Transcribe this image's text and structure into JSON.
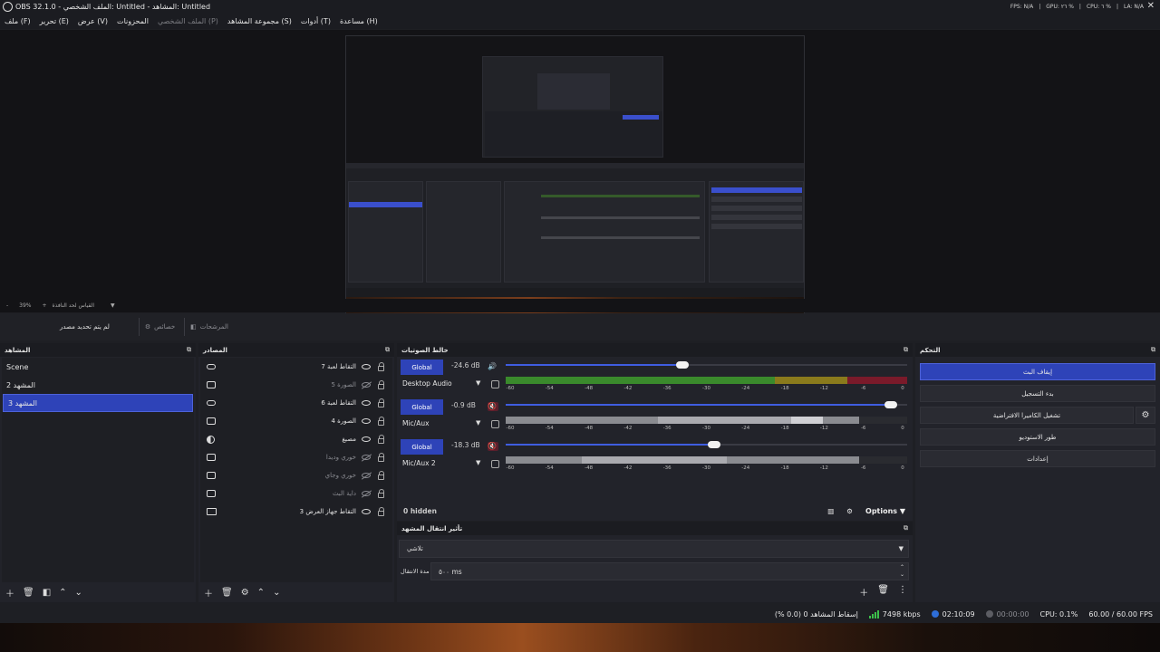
{
  "window": {
    "title": "OBS 32.1.0 - الملف الشخصي: Untitled - المشاهد: Untitled",
    "status_right": [
      "FPS: N/A",
      "GPU: ٢٦ %",
      "CPU: ٦ %",
      "LA: N/A"
    ]
  },
  "menu": [
    "ملف (F)",
    "تحرير (E)",
    "عرض (V)",
    "المحزونات",
    "الملف الشخصي (P)",
    "مجموعة المشاهد (S)",
    "أدوات (T)",
    "مساعدة (H)"
  ],
  "zoom": {
    "minus": "-",
    "percent": "39%",
    "plus": "+",
    "fit": "القياس لحد النافذة"
  },
  "context": {
    "no_source": "لم يتم تحديد مصدر",
    "properties": "خصائص",
    "filters": "المرشحات"
  },
  "scenes": {
    "title": "المشاهد",
    "items": [
      "Scene",
      "المشهد 2",
      "المشهد 3"
    ],
    "active_index": 2
  },
  "sources": {
    "title": "المصادر",
    "items": [
      {
        "name": "التقاط لعبة 7",
        "icon": "gamepad-icon",
        "visible": true
      },
      {
        "name": "الصورة 5",
        "icon": "image-icon",
        "visible": false
      },
      {
        "name": "التقاط لعبة 6",
        "icon": "gamepad-icon",
        "visible": true
      },
      {
        "name": "الصورة 4",
        "icon": "image-icon",
        "visible": true
      },
      {
        "name": "مصبغ",
        "icon": "color-source-icon",
        "visible": true
      },
      {
        "name": "خوري وديدا",
        "icon": "image-icon",
        "visible": false
      },
      {
        "name": "خوري وجاي",
        "icon": "image-icon",
        "visible": false
      },
      {
        "name": "داية البث",
        "icon": "image-icon",
        "visible": false
      },
      {
        "name": "التقاط جهاز العرض 3",
        "icon": "display-capture-icon",
        "visible": true
      }
    ]
  },
  "mixer": {
    "title": "خالط الصوتيات",
    "channels": [
      {
        "label": "Global",
        "db": "-24.6 dB",
        "name": "Desktop Audio",
        "muted": false,
        "volume": 0.44
      },
      {
        "label": "Global",
        "db": "-0.9 dB",
        "name": "Mic/Aux",
        "muted": true,
        "volume": 0.96
      },
      {
        "label": "Global",
        "db": "-18.3 dB",
        "name": "Mic/Aux 2",
        "muted": true,
        "volume": 0.52
      }
    ],
    "scale": [
      "-60",
      "-54",
      "-48",
      "-42",
      "-36",
      "-30",
      "-24",
      "-18",
      "-12",
      "-6",
      "0"
    ],
    "hidden": "0 hidden",
    "options": "Options"
  },
  "transitions": {
    "title": "تأثير انتقال المشهد",
    "selected": "تلاشي",
    "duration_label": "مدة الانتقال",
    "duration_value": "٥٠٠ ms"
  },
  "controls": {
    "title": "التحكم",
    "buttons": [
      "إيقاف البث",
      "بدء التسجيل",
      "تشغيل الكاميرا الافتراضية",
      "طور الاستوديو",
      "إعدادات"
    ]
  },
  "status": {
    "dropped": "إسقاط المشاهد 0 (0.0 %)",
    "bitrate": "7498 kbps",
    "stream_time": "02:10:09",
    "rec_time": "00:00:00",
    "cpu": "CPU: 0.1%",
    "fps": "60.00 / 60.00 FPS"
  },
  "colors": {
    "accent": "#2e43b8",
    "meter_green": "#3a8a2c",
    "meter_yellow": "#8a7a1c",
    "meter_red": "#8a1a2a",
    "muted_red": "#ff5a78"
  }
}
